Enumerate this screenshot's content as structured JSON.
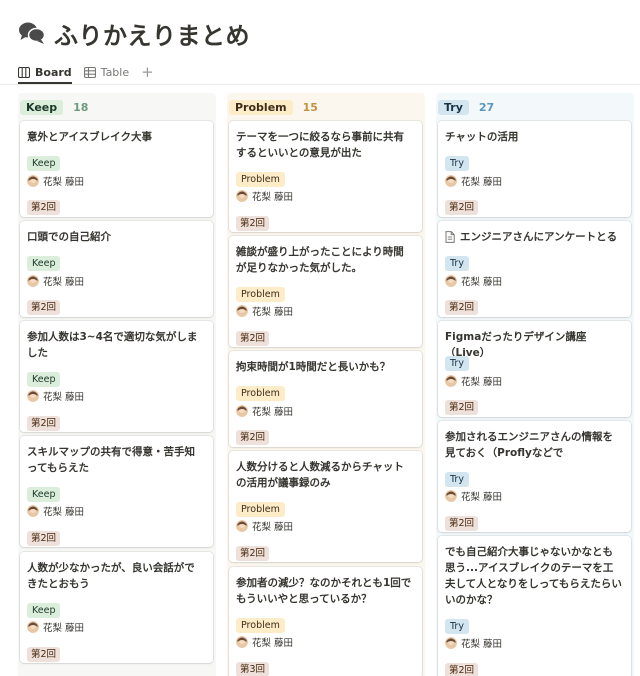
{
  "page": {
    "title": "ふりかえりまとめ",
    "icon": "speech-bubbles-icon"
  },
  "views": [
    {
      "label": "Board",
      "icon": "board-icon",
      "active": true
    },
    {
      "label": "Table",
      "icon": "table-icon",
      "active": false
    }
  ],
  "add_view_label": "+",
  "columns": [
    {
      "name": "Keep",
      "count": "18",
      "color": "#dbeddb",
      "cards": [
        {
          "title": "意外とアイスブレイク大事",
          "tag": "Keep",
          "person": "花梨 藤田",
          "round": "第2回"
        },
        {
          "title": "口頭での自己紹介",
          "tag": "Keep",
          "person": "花梨 藤田",
          "round": "第2回"
        },
        {
          "title": "参加人数は3~4名で適切な気がしました",
          "tag": "Keep",
          "person": "花梨 藤田",
          "round": "第2回"
        },
        {
          "title": "スキルマップの共有で得意・苦手知ってもらえた",
          "tag": "Keep",
          "person": "花梨 藤田",
          "round": "第2回"
        },
        {
          "title": "人数が少なかったが、良い会話ができたとおもう",
          "tag": "Keep",
          "person": "花梨 藤田",
          "round": "第2回"
        }
      ]
    },
    {
      "name": "Problem",
      "count": "15",
      "color": "#fdecc8",
      "cards": [
        {
          "title": "テーマを一つに絞るなら事前に共有するといいとの意見が出た",
          "tag": "Problem",
          "person": "花梨 藤田",
          "round": "第2回"
        },
        {
          "title": "雑談が盛り上がったことにより時間が足りなかった気がした。",
          "tag": "Problem",
          "person": "花梨 藤田",
          "round": "第2回"
        },
        {
          "title": "拘束時間が1時間だと長いかも？",
          "tag": "Problem",
          "person": "花梨 藤田",
          "round": "第2回"
        },
        {
          "title": "人数分けると人数減るからチャットの活用が議事録のみ",
          "tag": "Problem",
          "person": "花梨 藤田",
          "round": "第2回"
        },
        {
          "title": "参加者の減少？なのかそれとも1回でもういいやと思っているか？",
          "tag": "Problem",
          "person": "花梨 藤田",
          "round": "第3回"
        }
      ]
    },
    {
      "name": "Try",
      "count": "27",
      "color": "#d3e5ef",
      "cards": [
        {
          "title": "チャットの活用",
          "tag": "Try",
          "person": "花梨 藤田",
          "round": "第2回",
          "doc": false
        },
        {
          "title": "エンジニアさんにアンケートとる",
          "tag": "Try",
          "person": "花梨 藤田",
          "round": "第2回",
          "doc": true
        },
        {
          "title": "Figmaだったりデザイン講座（Live）",
          "tag": "Try",
          "person": "花梨 藤田",
          "round": "第2回",
          "doc": false
        },
        {
          "title": "参加されるエンジニアさんの情報を見ておく（Proflyなどで",
          "tag": "Try",
          "person": "花梨 藤田",
          "round": "第2回",
          "doc": false
        },
        {
          "title": "でも自己紹介大事じゃないかなとも思う...アイスブレイクのテーマを工夫して人となりをしってもらえたらいいのかな？",
          "tag": "Try",
          "person": "花梨 藤田",
          "round": "第2回",
          "doc": false
        }
      ]
    }
  ]
}
